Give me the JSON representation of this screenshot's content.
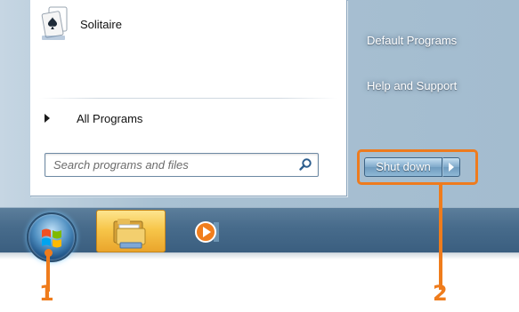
{
  "start_menu": {
    "programs": [
      {
        "label": "Solitaire",
        "icon": "solitaire-icon"
      }
    ],
    "all_programs_label": "All Programs",
    "search": {
      "placeholder": "Search programs and files",
      "value": ""
    },
    "right_links": [
      {
        "label": "Default Programs"
      },
      {
        "label": "Help and Support"
      }
    ],
    "shutdown_label": "Shut down"
  },
  "taskbar": {
    "items": [
      {
        "name": "start-button",
        "icon": "windows-logo-icon"
      },
      {
        "name": "windows-explorer",
        "icon": "folder-icon",
        "active": true
      },
      {
        "name": "windows-media-player",
        "icon": "media-player-icon"
      }
    ]
  },
  "callouts": [
    {
      "number": "1",
      "target": "start-button"
    },
    {
      "number": "2",
      "target": "shutdown-button"
    }
  ],
  "colors": {
    "callout": "#ef7c1c",
    "taskbar": "#486c8c",
    "right_pane": "#a9c1d3"
  }
}
